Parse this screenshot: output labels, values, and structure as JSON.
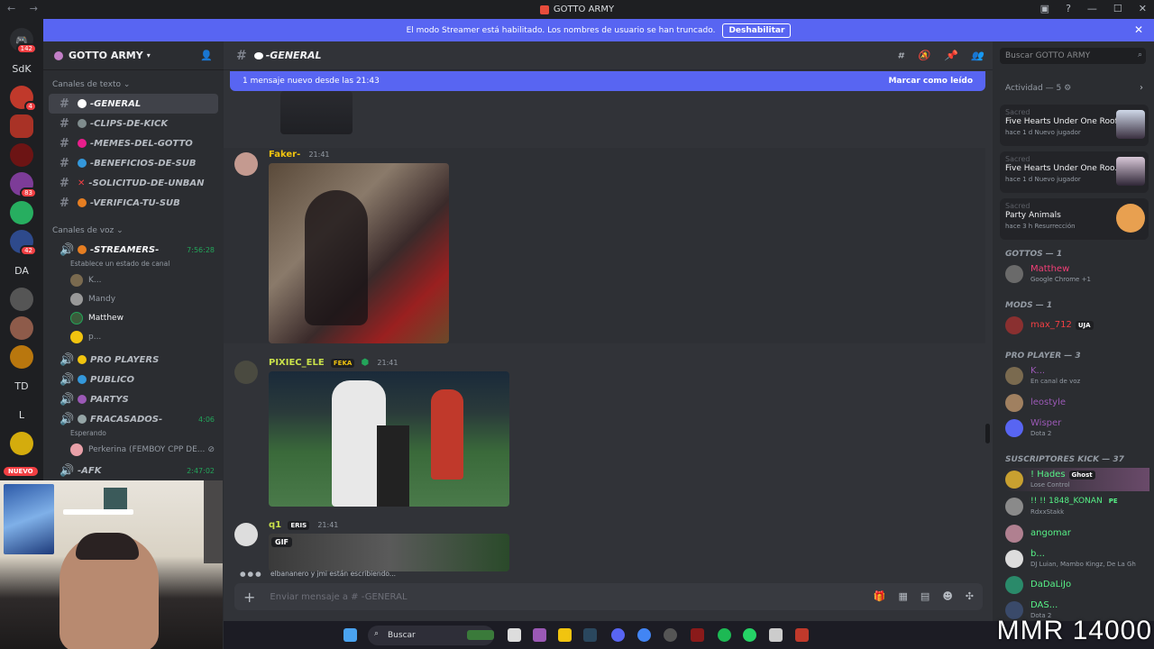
{
  "title_bar": {
    "title": "GOTTO ARMY"
  },
  "banner": {
    "text": "El modo Streamer está habilitado. Los nombres de usuario se han truncado.",
    "button": "Deshabilitar"
  },
  "servers": [
    {
      "label": "",
      "badge": "142"
    },
    {
      "label": "SdK",
      "badge": ""
    },
    {
      "label": "",
      "badge": "4"
    },
    {
      "label": "",
      "badge": ""
    },
    {
      "label": "",
      "badge": ""
    },
    {
      "label": "",
      "badge": "83"
    },
    {
      "label": "",
      "badge": ""
    },
    {
      "label": "",
      "badge": "42"
    },
    {
      "label": "DA",
      "badge": ""
    },
    {
      "label": "",
      "badge": ""
    },
    {
      "label": "",
      "badge": ""
    },
    {
      "label": "",
      "badge": ""
    },
    {
      "label": "TD",
      "badge": ""
    },
    {
      "label": "L",
      "badge": ""
    },
    {
      "label": "",
      "badge": ""
    }
  ],
  "new_badge": "NUEVO",
  "guild": {
    "name": "GOTTO ARMY"
  },
  "text_category": "Canales de texto",
  "text_channels": [
    "-GENERAL",
    "-CLIPS-DE-KICK",
    "-MEMES-DEL-GOTTO",
    "-BENEFICIOS-DE-SUB",
    "-SOLICITUD-DE-UNBAN",
    "-VERIFICA-TU-SUB"
  ],
  "voice_category": "Canales de voz",
  "voice": {
    "streamers": {
      "name": "-STREAMERS-",
      "time": "7:56:28",
      "status": "Establece un estado de canal",
      "users": [
        "K...",
        "Mandy",
        "Matthew",
        "p..."
      ]
    },
    "pro_players": "PRO PLAYERS",
    "publico": "PUBLICO",
    "partys": "PARTYS",
    "fracasados": {
      "name": "FRACASADOS-",
      "time": "4:06",
      "status": "Esperando",
      "user": "Perkerina (FEMBOY CPP DE..."
    },
    "afk": {
      "name": "-AFK",
      "time": "2:47:02"
    }
  },
  "channel_header": {
    "name": "-GENERAL"
  },
  "search": {
    "placeholder": "Buscar GOTTO ARMY"
  },
  "new_messages": {
    "text": "1 mensaje nuevo desde las 21:43",
    "action": "Marcar como leído"
  },
  "messages": [
    {
      "author": "Faker-",
      "time": "21:41",
      "tag": ""
    },
    {
      "author": "PIXIEC_ELE",
      "time": "21:41",
      "tag": "FEKA"
    },
    {
      "author": "q1",
      "time": "21:41",
      "tag": "ERIS",
      "media_label": "GIF"
    }
  ],
  "typing": {
    "text": "elbananero y jmi están escribiendo..."
  },
  "composer": {
    "placeholder": "Enviar mensaje a #  -GENERAL"
  },
  "activity": {
    "header": "Actividad — 5",
    "cards": [
      {
        "game": "Sacred",
        "title": "Five Hearts Under One Roof",
        "status": "hace 1 d   Nuevo jugador"
      },
      {
        "game": "Sacred",
        "title": "Five Hearts Under One Roo...",
        "status": "hace 1 d   Nuevo jugador"
      },
      {
        "game": "Sacred",
        "title": "Party Animals",
        "status": "hace 3 h   Resurrección"
      }
    ]
  },
  "member_groups": {
    "gottos": "GOTTOS — 1",
    "mods": "MODS — 1",
    "pro": "PRO PLAYER — 3",
    "subs": "SUSCRIPTORES KICK — 37"
  },
  "members": [
    {
      "name": "Matthew",
      "status": "Google Chrome +1",
      "color": "#f23f77"
    },
    {
      "name": "max_712",
      "status": "",
      "tag": "UJA",
      "color": "#f23f43"
    },
    {
      "name": "K...",
      "status": "En canal de voz",
      "color": "#9b59b6"
    },
    {
      "name": "leostyle",
      "status": "",
      "color": "#9b59b6"
    },
    {
      "name": "Wisper",
      "status": "Dota 2",
      "color": "#9b59b6"
    },
    {
      "name": "! Hades",
      "status": "Lose Control",
      "tag": "Ghost",
      "color": "#57f287"
    },
    {
      "name": "!! !! 1848_KONAN",
      "status": "RdxxStakk",
      "tag": "PE",
      "color": "#57f287"
    },
    {
      "name": "angomar",
      "status": "",
      "color": "#57f287"
    },
    {
      "name": "b...",
      "status": "DJ Luian, Mambo Kingz, De La Gh",
      "color": "#57f287"
    },
    {
      "name": "DaDaLiJo",
      "status": "",
      "color": "#57f287"
    },
    {
      "name": "DAS...",
      "status": "Dota 2",
      "color": "#57f287"
    }
  ],
  "taskbar": {
    "search": "Buscar"
  },
  "overlay": {
    "mmr": "MMR 14000"
  }
}
